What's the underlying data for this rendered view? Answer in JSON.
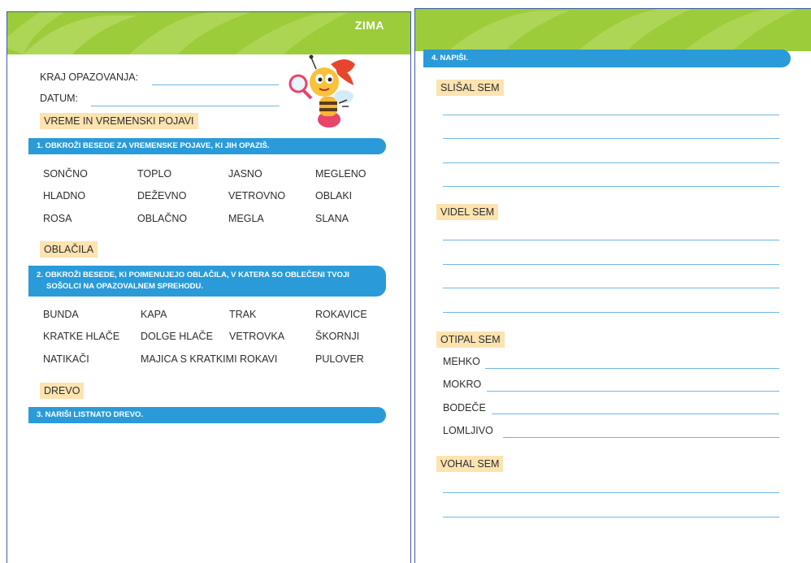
{
  "header": {
    "title": "ZIMA"
  },
  "form": {
    "location_label": "KRAJ OPAZOVANJA:",
    "date_label": "DATUM:"
  },
  "sections": {
    "weather": {
      "tag": "VREME IN VREMENSKI POJAVI",
      "task": "1. OBKROŽI BESEDE ZA VREMENSKE POJAVE, KI JIH OPAZIŠ.",
      "words": [
        [
          "SONČNO",
          "TOPLO",
          "JASNO",
          "MEGLENO"
        ],
        [
          "HLADNO",
          "DEŽEVNO",
          "VETROVNO",
          "OBLAKI"
        ],
        [
          "ROSA",
          "OBLAČNO",
          "MEGLA",
          "SLANA"
        ]
      ]
    },
    "clothes": {
      "tag": "OBLAČILA",
      "task_line1": "2. OBKROŽI BESEDE, KI POIMENUJEJO OBLAČILA, V KATERA SO OBLEČENI TVOJI",
      "task_line2": "SOŠOLCI NA OPAZOVALNEM SPREHODU.",
      "words": [
        [
          "BUNDA",
          "KAPA",
          "TRAK",
          "ROKAVICE"
        ],
        [
          "KRATKE HLAČE",
          "DOLGE HLAČE",
          "VETROVKA",
          "ŠKORNJI"
        ],
        [
          "NATIKAČI",
          "MAJICA S KRATKIMI ROKAVI",
          "PULOVER"
        ]
      ]
    },
    "tree": {
      "tag": "DREVO",
      "task": "3. NARIŠI LISTNATO DREVO."
    },
    "write": {
      "task": "4. NAPIŠI.",
      "heard": "SLIŠAL SEM",
      "seen": "VIDEL SEM",
      "touched": "OTIPAL SEM",
      "touched_items": [
        "MEHKO",
        "MOKRO",
        "BODEČE",
        "LOMLJIVO"
      ],
      "smelled": "VOHAL SEM"
    }
  },
  "colors": {
    "header_green": "#9ccc3a",
    "task_bar_blue": "#2a9bd8",
    "tag_peach": "#fde3b0",
    "line_blue": "#6fb6e3",
    "page_border": "#3c5aa8"
  }
}
